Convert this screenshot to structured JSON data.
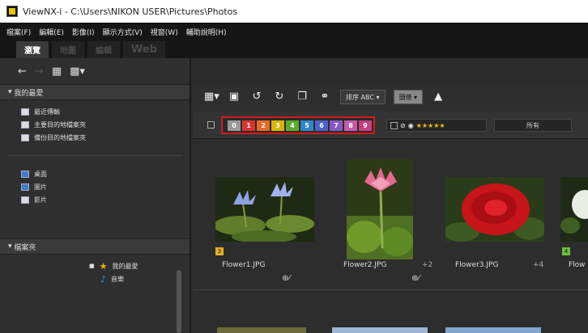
{
  "window": {
    "title": "ViewNX-i - C:\\Users\\NIKON USER\\Pictures\\Photos"
  },
  "menu": [
    "檔案(F)",
    "編輯(E)",
    "影像(I)",
    "顯示方式(V)",
    "視窗(W)",
    "輔助說明(H)"
  ],
  "mode_tabs": [
    {
      "label": "瀏覽",
      "active": true
    },
    {
      "label": "地圖",
      "active": false
    },
    {
      "label": "編輯",
      "active": false
    },
    {
      "label": "Web",
      "active": false
    }
  ],
  "sidebar": {
    "favorites_title": "我的最愛",
    "favorites": [
      "最近傳輸",
      "主要目的地檔案夾",
      "備份目的地檔案夾"
    ],
    "places": [
      "桌面",
      "圖片",
      "影片"
    ],
    "folders_title": "檔案夾",
    "tree": [
      "我的最愛",
      "音樂"
    ]
  },
  "toolbar": {
    "sort_label": "排序 ABC",
    "view_label": "頭條"
  },
  "filter": {
    "labels": [
      {
        "text": "0",
        "color": "#9a9a9a"
      },
      {
        "text": "1",
        "color": "#d9342b"
      },
      {
        "text": "2",
        "color": "#e56a2a"
      },
      {
        "text": "3",
        "color": "#d8b400"
      },
      {
        "text": "4",
        "color": "#5caa2a"
      },
      {
        "text": "5",
        "color": "#2f86c8"
      },
      {
        "text": "6",
        "color": "#4b63c9"
      },
      {
        "text": "7",
        "color": "#8358c2"
      },
      {
        "text": "8",
        "color": "#c55aa8"
      },
      {
        "text": "9",
        "color": "#c44080"
      }
    ],
    "stars": "★★★★★",
    "all_label": "所有"
  },
  "photos": [
    {
      "name": "Flower1.JPG",
      "label": "3",
      "label_color": "#e0b020"
    },
    {
      "name": "Flower2.JPG",
      "extra": "+2"
    },
    {
      "name": "Flower3.JPG",
      "extra": "+4"
    },
    {
      "name": "Flow",
      "label": "4",
      "label_color": "#6cbf3a"
    }
  ]
}
